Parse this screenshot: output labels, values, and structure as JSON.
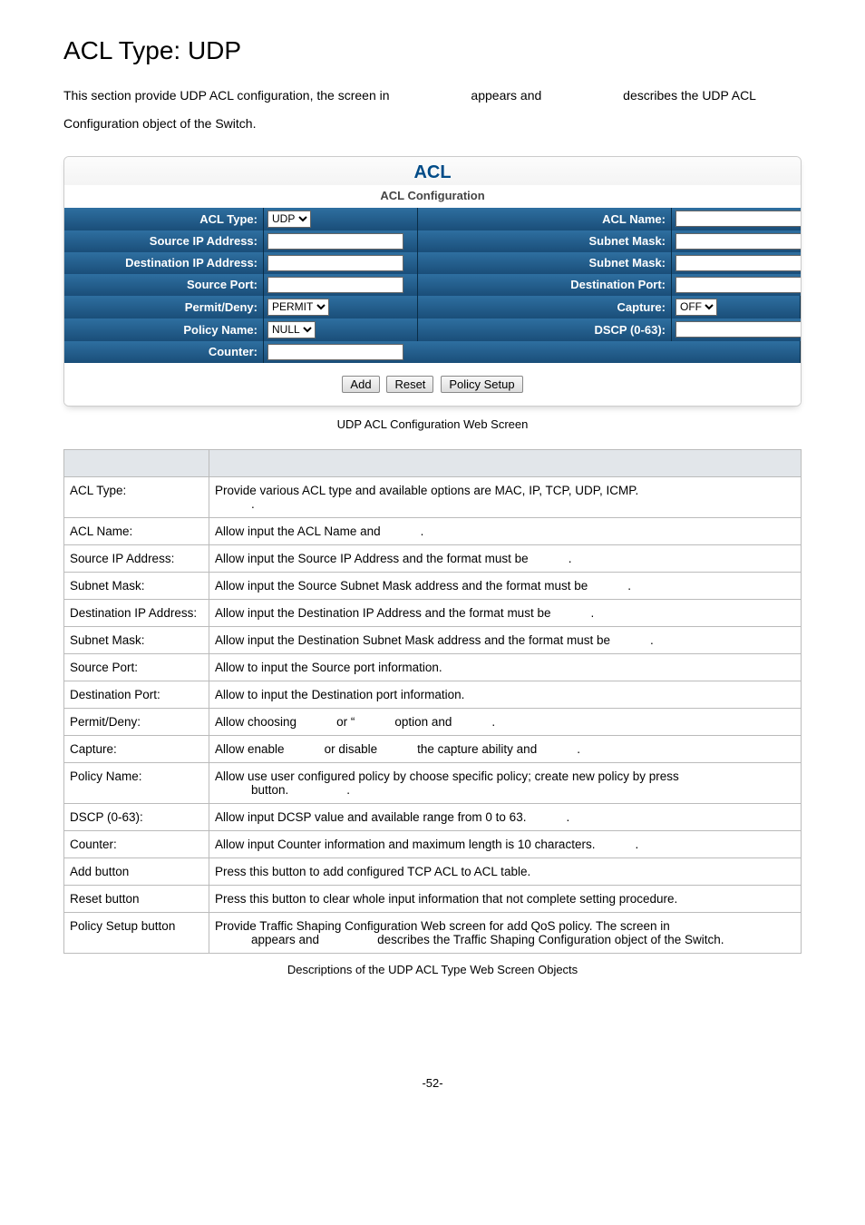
{
  "heading": "ACL Type: UDP",
  "intro": {
    "seg1": "This section provide UDP ACL configuration, the screen in",
    "seg2": "appears and",
    "seg3": "describes the UDP ACL",
    "seg4": "Configuration object of the Switch."
  },
  "panel": {
    "title": "ACL",
    "subtitle": "ACL Configuration",
    "labels": {
      "acl_type": "ACL Type:",
      "acl_name": "ACL Name:",
      "src_ip": "Source IP Address:",
      "subnet1": "Subnet Mask:",
      "dst_ip": "Destination IP Address:",
      "subnet2": "Subnet Mask:",
      "src_port": "Source Port:",
      "dst_port": "Destination Port:",
      "permit": "Permit/Deny:",
      "capture": "Capture:",
      "policy": "Policy Name:",
      "dscp": "DSCP (0-63):",
      "counter": "Counter:"
    },
    "values": {
      "acl_type": "UDP",
      "permit": "PERMIT",
      "capture": "OFF",
      "policy": "NULL"
    },
    "buttons": {
      "add": "Add",
      "reset": "Reset",
      "policy_setup": "Policy Setup"
    }
  },
  "figure_caption": "UDP ACL Configuration Web Screen",
  "table_caption": "Descriptions of the UDP ACL Type Web Screen Objects",
  "rows": [
    {
      "obj": "ACL Type:",
      "segs": [
        "Provide various ACL type and available options are MAC, IP, TCP, UDP, ICMP."
      ],
      "extra": "."
    },
    {
      "obj": "ACL Name:",
      "segs": [
        "Allow input the ACL Name and",
        "."
      ]
    },
    {
      "obj": "Source IP Address:",
      "segs": [
        "Allow input the Source IP Address and the format must be",
        "."
      ]
    },
    {
      "obj": "Subnet Mask:",
      "segs": [
        "Allow input the Source Subnet Mask address and the format must be",
        "."
      ]
    },
    {
      "obj": "Destination IP Address:",
      "segs": [
        "Allow input the Destination IP Address and the format must be",
        "."
      ]
    },
    {
      "obj": "Subnet Mask:",
      "segs": [
        "Allow input the Destination Subnet Mask address and the format must be",
        "."
      ]
    },
    {
      "obj": "Source Port:",
      "segs": [
        "Allow to input the Source port information."
      ]
    },
    {
      "obj": "Destination Port:",
      "segs": [
        "Allow to input the Destination port information."
      ]
    },
    {
      "obj": "Permit/Deny:",
      "segs": [
        "Allow choosing",
        "or “",
        "option and",
        "."
      ]
    },
    {
      "obj": "Capture:",
      "segs": [
        "Allow enable",
        "or disable",
        "the capture ability and",
        "."
      ]
    },
    {
      "obj": "Policy Name:",
      "segs": [
        "Allow use user configured policy by choose specific policy; create new policy by press"
      ],
      "extra_segs": [
        "button.",
        "."
      ]
    },
    {
      "obj": "DSCP (0-63):",
      "segs": [
        "Allow input DCSP value and available range from 0 to 63.",
        "."
      ]
    },
    {
      "obj": "Counter:",
      "segs": [
        "Allow input Counter information and maximum length is 10 characters.",
        "."
      ]
    },
    {
      "obj": "Add button",
      "segs": [
        "Press this button to add configured TCP ACL to ACL table."
      ]
    },
    {
      "obj": "Reset button",
      "segs": [
        "Press this button to clear whole input information that not complete setting procedure."
      ]
    },
    {
      "obj": "Policy Setup button",
      "segs": [
        "Provide Traffic Shaping Configuration Web screen for add QoS policy. The screen in"
      ],
      "extra_segs": [
        "appears and",
        "describes the Traffic Shaping Configuration object of the Switch."
      ]
    }
  ],
  "page_number": "-52-"
}
